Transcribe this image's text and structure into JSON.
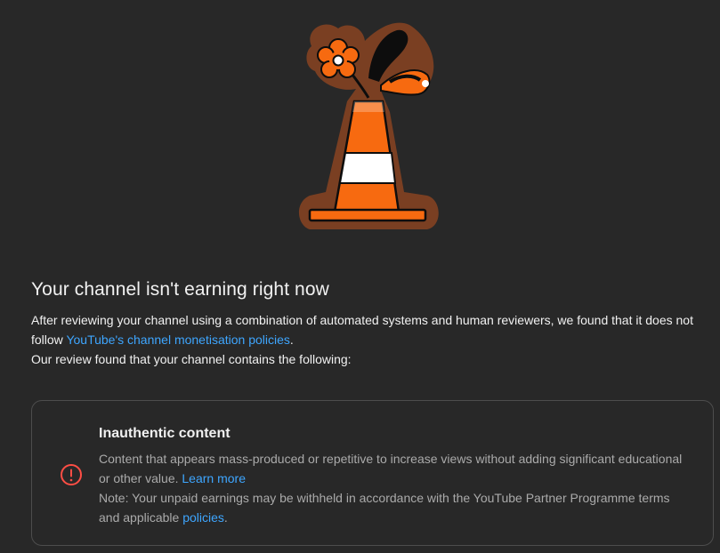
{
  "hero": {
    "illustration": "traffic-cone-with-flower-illustration",
    "colors": {
      "cone_orange": "#f76a10",
      "cone_stripe": "#ffffff",
      "outline_brown": "#7a3f22",
      "background": "#282828"
    }
  },
  "status": {
    "title": "Your channel isn't earning right now",
    "line1_prefix": "After reviewing your channel using a combination of automated systems and human reviewers, we found that it does not follow ",
    "policy_link": "YouTube's channel monetisation policies",
    "line1_suffix": ".",
    "line2": "Our review found that your channel contains the following:"
  },
  "violation": {
    "icon": "error-circle-icon",
    "icon_color": "#ff4e45",
    "title": "Inauthentic content",
    "description": "Content that appears mass-produced or repetitive to increase views without adding significant educational or other value.",
    "learn_more": "Learn more",
    "note_prefix": "Note: Your unpaid earnings may be withheld in accordance with the YouTube Partner Programme terms and applicable ",
    "policies_link": "policies",
    "note_suffix": "."
  }
}
